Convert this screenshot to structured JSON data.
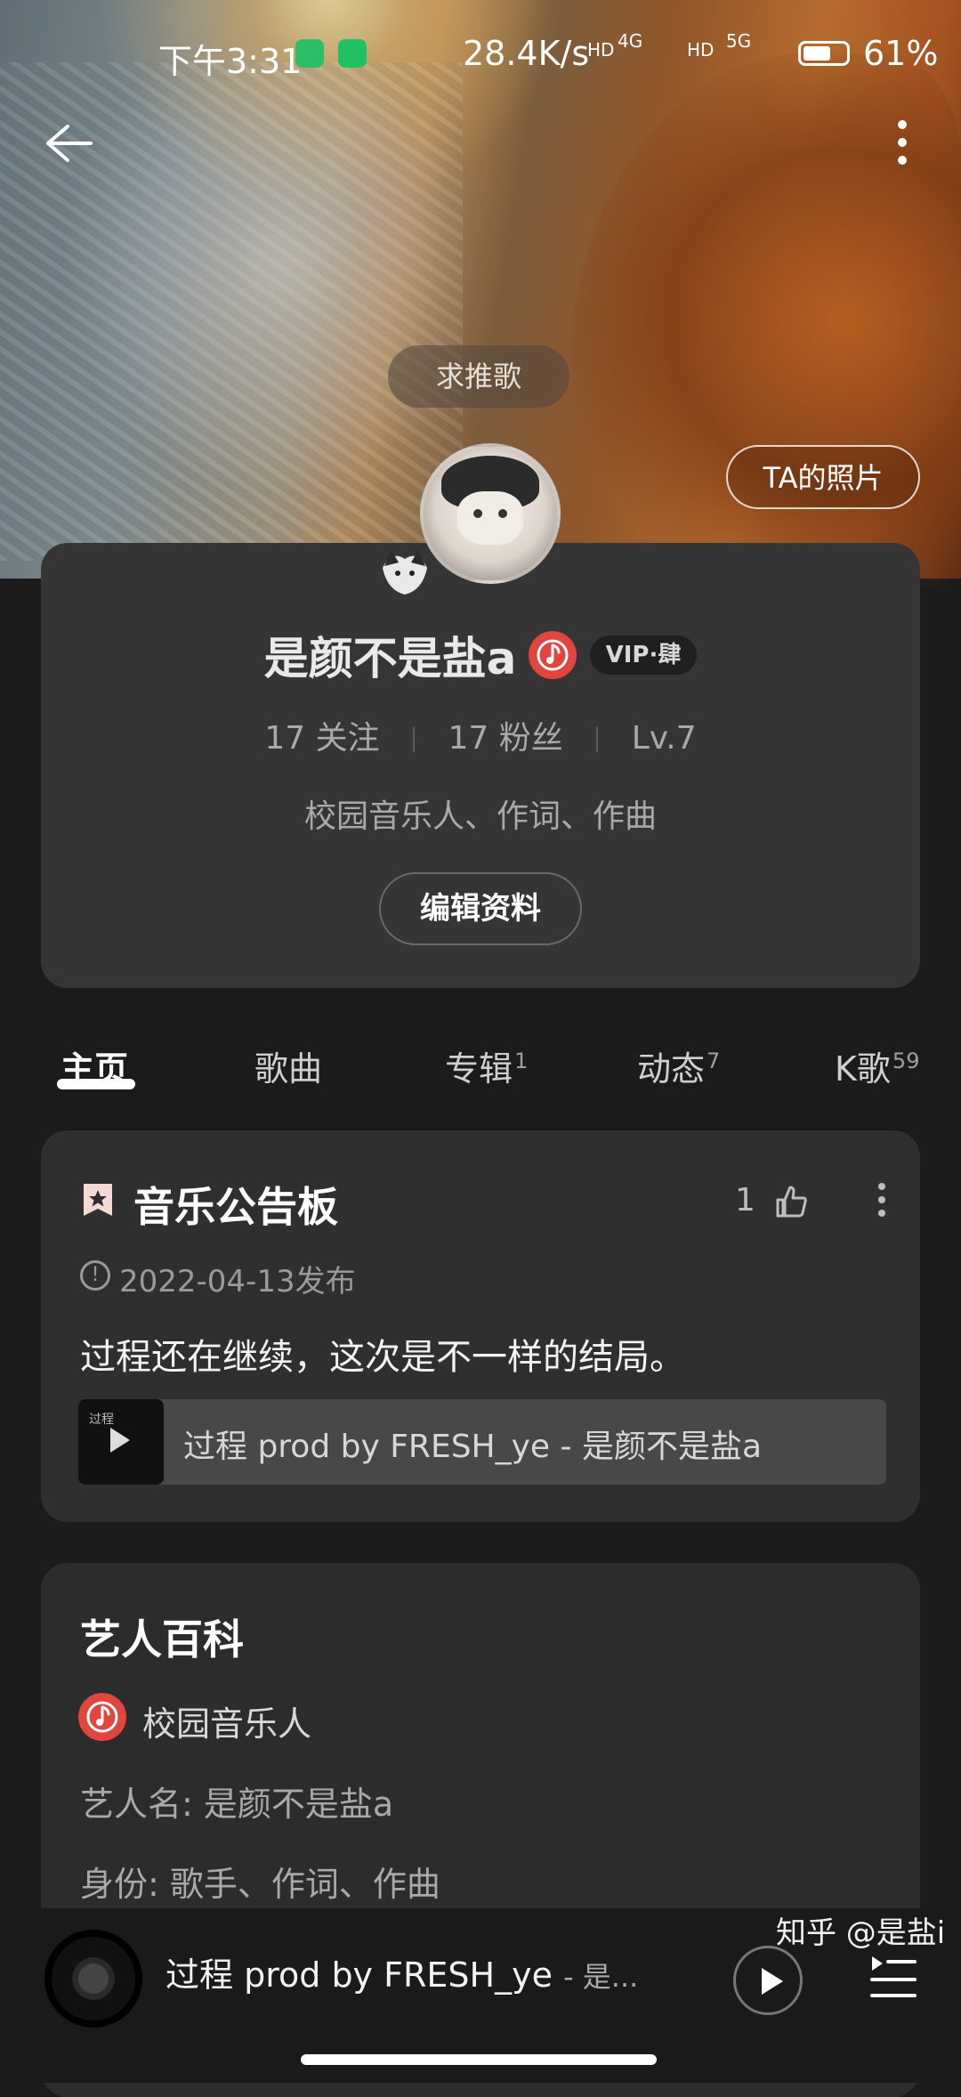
{
  "status_bar": {
    "time": "下午3:31",
    "network_speed": "28.4K/s",
    "battery": "61%",
    "signal_labels": [
      "HD",
      "4G",
      "HD",
      "5G"
    ]
  },
  "header": {
    "request_chip": "求推歌",
    "photo_button": "TA的照片"
  },
  "profile": {
    "name": "是颜不是盐a",
    "vip_badge": "VIP·肆",
    "following": "17 关注",
    "followers": "17 粉丝",
    "level": "Lv.7",
    "bio": "校园音乐人、作词、作曲",
    "edit_button": "编辑资料"
  },
  "tabs": [
    {
      "label": "主页",
      "count": ""
    },
    {
      "label": "歌曲",
      "count": ""
    },
    {
      "label": "专辑",
      "count": "1"
    },
    {
      "label": "动态",
      "count": "7"
    },
    {
      "label": "K歌",
      "count": "59"
    }
  ],
  "board": {
    "title": "音乐公告板",
    "likes": "1",
    "date": "2022-04-13发布",
    "text": "过程还在继续，这次是不一样的结局。",
    "song": "过程 prod by FRESH_ye - 是颜不是盐a",
    "thumb_text": "过程"
  },
  "encyclopedia": {
    "title": "艺人百科",
    "badge_label": "校园音乐人",
    "artist_name": "艺人名: 是颜不是盐a",
    "identity": "身份: 歌手、作词、作曲"
  },
  "player": {
    "title": "过程 prod by FRESH_ye",
    "artist": "- 是..."
  },
  "watermark": "知乎 @是盐i",
  "colors": {
    "accent_red": "#e2453d",
    "card_bg": "#353535",
    "page_bg": "#1b1b1c"
  }
}
